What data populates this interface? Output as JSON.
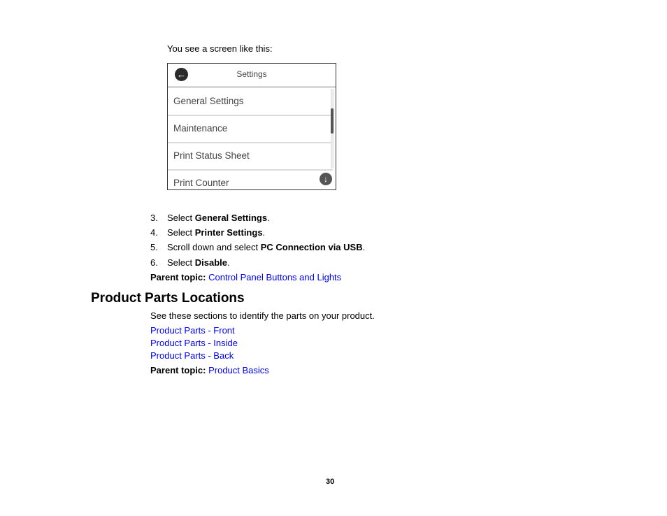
{
  "intro_text": "You see a screen like this:",
  "screen": {
    "title": "Settings",
    "back_icon": "arrow-left-circle-icon",
    "items": [
      {
        "label": "General Settings"
      },
      {
        "label": "Maintenance"
      },
      {
        "label": "Print Status Sheet"
      },
      {
        "label": "Print Counter"
      }
    ],
    "scroll_down_icon": "arrow-down-circle-icon"
  },
  "steps": [
    {
      "number": "3.",
      "prefix": "Select ",
      "bold": "General Settings",
      "suffix": "."
    },
    {
      "number": "4.",
      "prefix": "Select ",
      "bold": "Printer Settings",
      "suffix": "."
    },
    {
      "number": "5.",
      "prefix": "Scroll down and select ",
      "bold": "PC Connection via USB",
      "suffix": "."
    },
    {
      "number": "6.",
      "prefix": "Select ",
      "bold": "Disable",
      "suffix": "."
    }
  ],
  "parent_topic_1": {
    "label": "Parent topic:",
    "link": "Control Panel Buttons and Lights"
  },
  "section": {
    "title": "Product Parts Locations",
    "description": "See these sections to identify the parts on your product.",
    "links": [
      {
        "label": "Product Parts - Front"
      },
      {
        "label": "Product Parts - Inside"
      },
      {
        "label": "Product Parts - Back"
      }
    ],
    "parent_topic": {
      "label": "Parent topic:",
      "link": "Product Basics"
    }
  },
  "page_number": "30",
  "colors": {
    "link": "#0000ee",
    "text": "#000000"
  }
}
